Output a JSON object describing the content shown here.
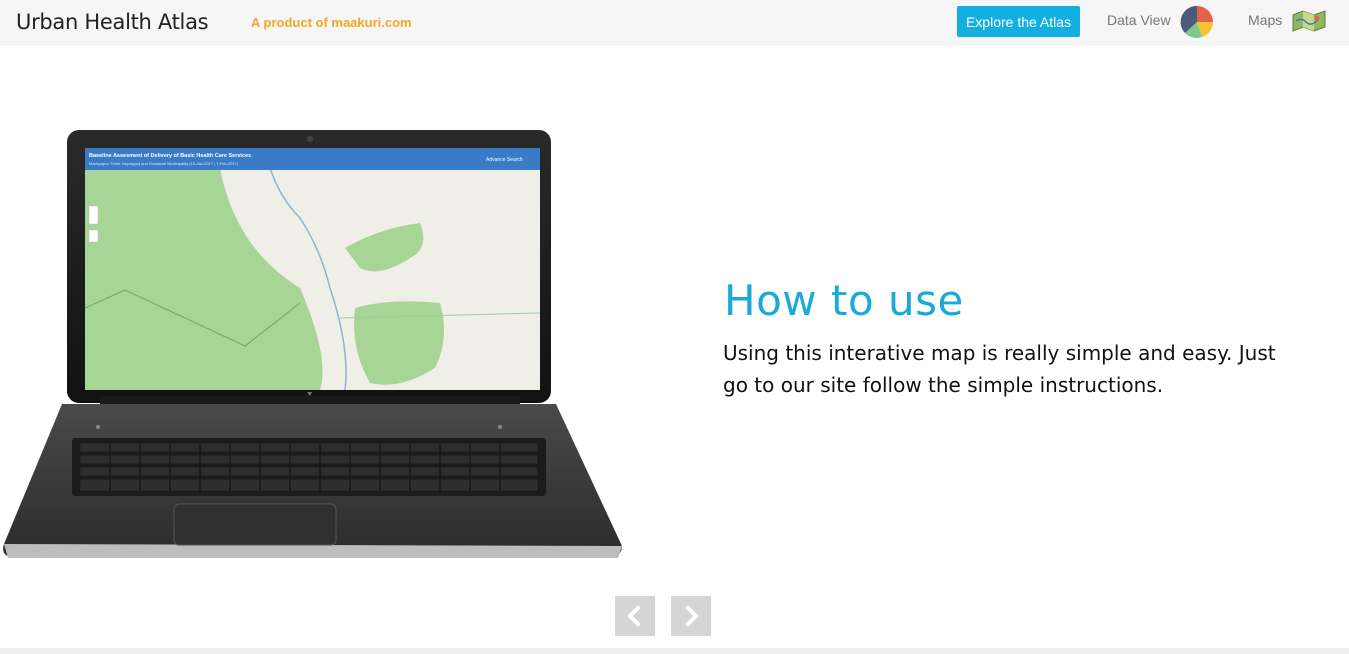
{
  "header": {
    "brand": "Urban Health Atlas",
    "tagline": "A product of maakuri.com",
    "explore_label": "Explore the Atlas",
    "data_view_label": "Data View",
    "maps_label": "Maps",
    "icons": {
      "data_view": "pie-chart-icon",
      "maps": "folded-map-icon"
    }
  },
  "screen": {
    "map_title": "Baseline Assesment of Delivery of Basic Health Care Services",
    "map_subtitle": "Madhyapur Thimi, Nepalgunj and Godawari Municipality (15-Jan-2017 | 7-Feb-2017)",
    "advance_search": "Advance Search"
  },
  "content": {
    "title": "How to use",
    "description": "Using this interative map is really simple and easy. Just go to our site follow the simple instructions."
  },
  "carousel": {
    "prev_icon": "chevron-left-icon",
    "next_icon": "chevron-right-icon"
  },
  "colors": {
    "accent": "#13afe0",
    "tagline": "#f5a623",
    "title": "#19aad8",
    "map_header": "#3a7bc8"
  }
}
